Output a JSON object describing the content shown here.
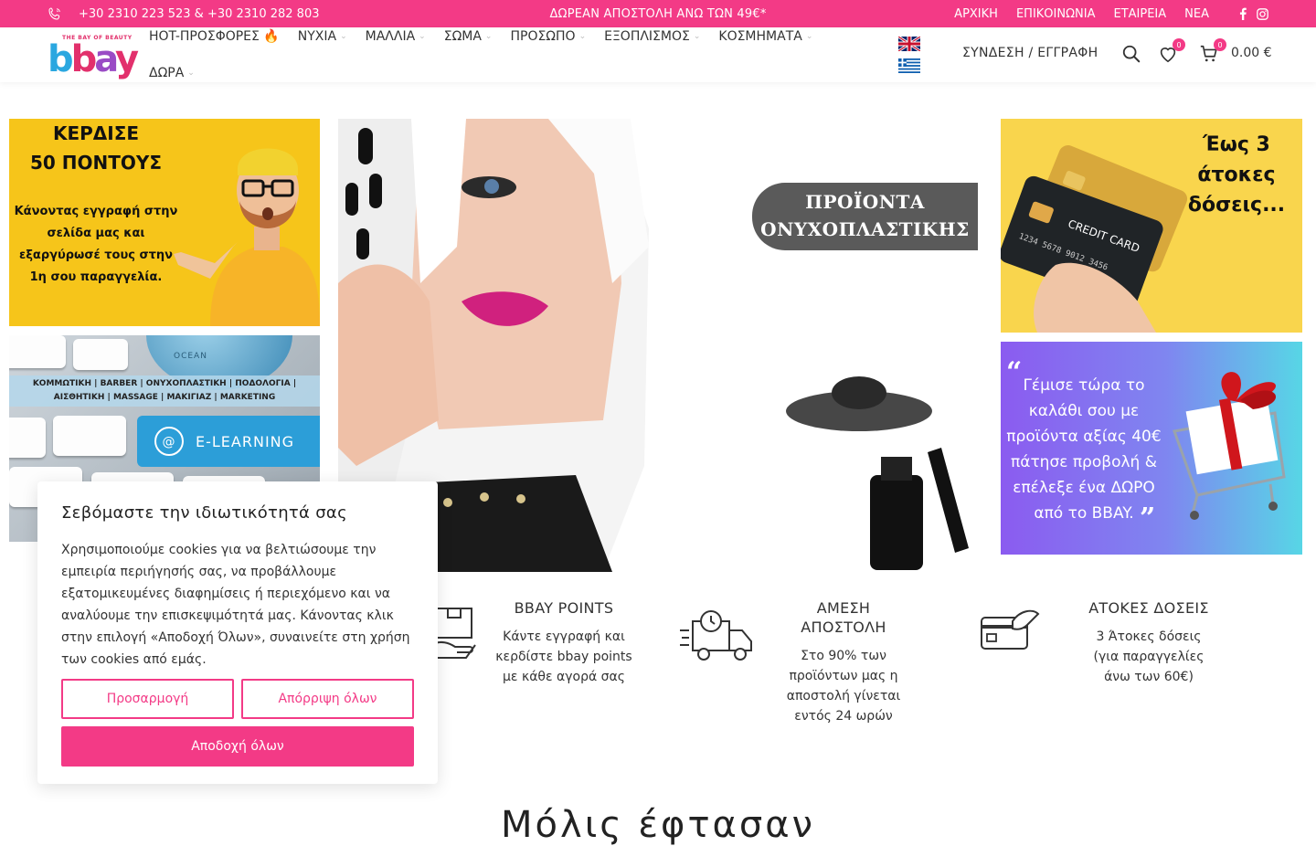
{
  "topbar": {
    "phones": "+30 2310 223 523 & +30 2310 282 803",
    "promo": "ΔΩΡΕΑΝ ΑΠΟΣΤΟΛΗ ΑΝΩ ΤΩΝ 49€*",
    "links": [
      "ΑΡΧΙΚΗ",
      "ΕΠΙΚΟΙΝΩΝΙΑ",
      "ΕΤΑΙΡΕΙΑ",
      "ΝΕΑ"
    ]
  },
  "logo": {
    "tagline": "THE BAY OF BEAUTY",
    "word": [
      "b",
      "b",
      "a",
      "y"
    ]
  },
  "nav": {
    "row1": [
      "HOT-ΠΡΟΣΦΟΡΕΣ 🔥",
      "ΝΥΧΙΑ",
      "ΜΑΛΛΙΑ",
      "ΣΩΜΑ",
      "ΠΡΟΣΩΠΟ",
      "ΕΞΟΠΛΙΣΜΟΣ",
      "ΚΟΣΜΗΜΑΤΑ"
    ],
    "row2": [
      "ΔΩΡΑ"
    ]
  },
  "header": {
    "login": "ΣΥΝΔΕΣΗ / ΕΓΓΡΑΦΗ",
    "wishlist_count": "0",
    "cart_count": "0",
    "cart_total": "0.00 €"
  },
  "banners": {
    "points": {
      "title1": "ΚΕΡΔΙΣΕ",
      "title2": "50 ΠΟΝΤΟΥΣ",
      "desc": "Κάνοντας εγγραφή στην σελίδα μας και εξαργύρωσέ τους στην 1η σου παραγγελία."
    },
    "elearning": {
      "categories": "ΚΟΜΜΩΤΙΚΗ | BARBER | ΟΝΥΧΟΠΛΑΣΤΙΚΗ | ΠΟΔΟΛΟΓΙΑ | ΑΙΣΘΗΤΙΚΗ | MASSAGE | ΜΑΚΙΓΙΑΖ | MARKETING",
      "key_label": "E-LEARNING",
      "globe_text": "OCEAN"
    },
    "hero": {
      "label": "ΠΡΟΪΟΝΤΑ ΟΝΥΧΟΠΛΑΣΤΙΚΗΣ"
    },
    "cards": {
      "text": "Έως 3 άτοκες δόσεις...",
      "card_text": "CREDIT CARD"
    },
    "gift": {
      "text": "Γέμισε τώρα το καλάθι σου με προϊόντα αξίας 40€ πάτησε προβολή & επέλεξε ένα ΔΩΡΟ από το BBAY."
    }
  },
  "features": [
    {
      "title": "BBAY POINTS",
      "desc": "Κάντε εγγραφή και κερδίστε bbay points με κάθε αγορά σας",
      "icon": "box-hand-icon"
    },
    {
      "title": "ΑΜΕΣΗ ΑΠΟΣΤΟΛΗ",
      "desc": "Στο 90% των προϊόντων μας η αποστολή γίνεται εντός 24 ωρών",
      "icon": "delivery-truck-icon"
    },
    {
      "title": "ΑΤΟΚΕΣ ΔΟΣΕΙΣ",
      "desc": "3 Άτοκες δόσεις (για παραγγελίες άνω των 60€)",
      "icon": "card-payment-icon"
    }
  ],
  "cookie": {
    "title": "Σεβόμαστε την ιδιωτικότητά σας",
    "body": "Χρησιμοποιούμε cookies για να βελτιώσουμε την εμπειρία περιήγησής σας, να προβάλλουμε εξατομικευμένες διαφημίσεις ή περιεχόμενο και να αναλύουμε την επισκεψιμότητά μας. Κάνοντας κλικ στην επιλογή «Αποδοχή Όλων», συναινείτε στη χρήση των cookies από εμάς.",
    "customize": "Προσαρμογή",
    "reject": "Απόρριψη όλων",
    "accept": "Αποδοχή όλων"
  },
  "section": {
    "title": "Μόλις έφτασαν"
  },
  "colors": {
    "brand": "#f33a86",
    "text": "#333333"
  }
}
